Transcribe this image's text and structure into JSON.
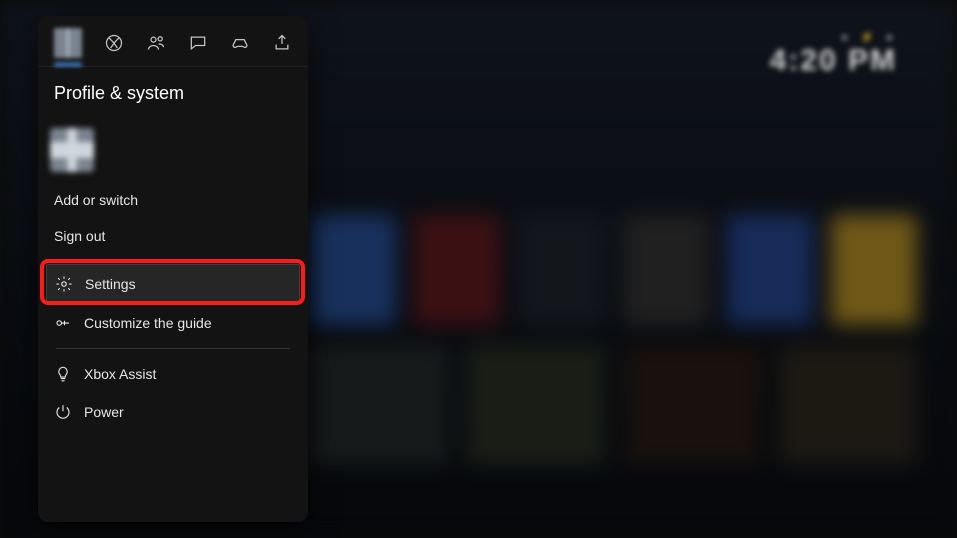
{
  "clock": {
    "status": "● ⚡ ●",
    "time": "4:20 PM"
  },
  "guide": {
    "title": "Profile & system",
    "items": {
      "add_switch": "Add or switch",
      "sign_out": "Sign out",
      "settings": "Settings",
      "customize": "Customize the guide",
      "assist": "Xbox Assist",
      "power": "Power"
    }
  }
}
